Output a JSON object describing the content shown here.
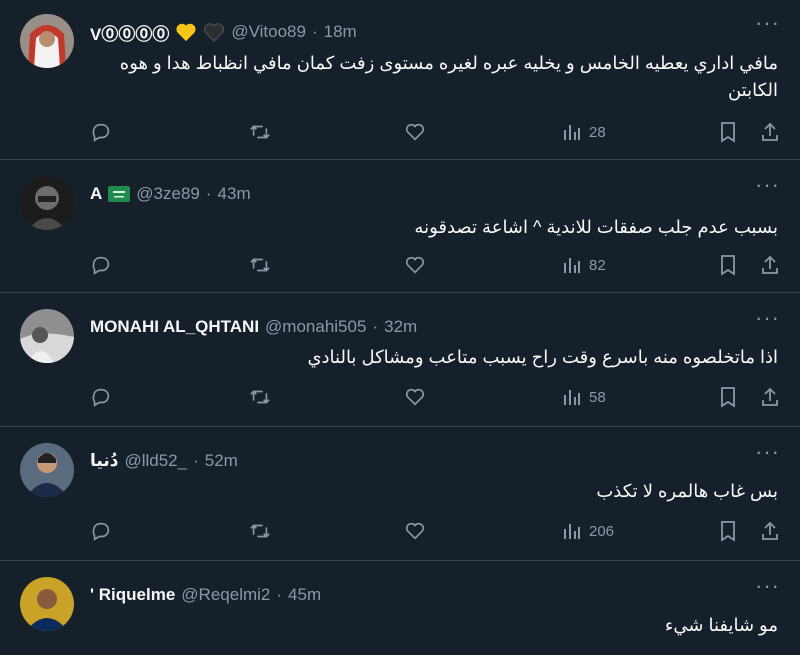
{
  "tweets": [
    {
      "name": "V⓪⓪⓪⓪",
      "badges": [
        "yellow-heart",
        "black-heart"
      ],
      "handle": "@Vitoo89",
      "time": "18m",
      "text": "مافي اداري يعطيه الخامس و يخليه عبره لغيره مستوى زفت كمان مافي انظباط هدا و هوه الكابتن",
      "views": "28"
    },
    {
      "name": "A",
      "badges": [
        "saudi-flag"
      ],
      "handle": "@3ze89",
      "time": "43m",
      "text": "بسبب عدم جلب صفقات للاندية ^ اشاعة تصدقونه",
      "views": "82"
    },
    {
      "name": "MONAHI AL_QHTANI",
      "badges": [],
      "handle": "@monahi505",
      "time": "32m",
      "text": "اذا ماتخلصوه منه باسرع وقت راح يسبب متاعب ومشاكل بالنادي",
      "views": "58"
    },
    {
      "name": "دُنيا",
      "badges": [],
      "handle": "@lld52_",
      "time": "52m",
      "text": "بس غاب هالمره لا تكذب",
      "views": "206"
    },
    {
      "name": "' Riquelme",
      "badges": [],
      "handle": "@Reqelmi2",
      "time": "45m",
      "text": "مو شايفنا شيء",
      "views": ""
    }
  ],
  "colors": {
    "background": "#15202b",
    "text": "#f7f9f9",
    "muted": "#8b98a5",
    "divider": "#38444d"
  },
  "icons": [
    "more-icon",
    "reply-icon",
    "retweet-icon",
    "like-icon",
    "views-icon",
    "bookmark-icon",
    "share-icon"
  ]
}
